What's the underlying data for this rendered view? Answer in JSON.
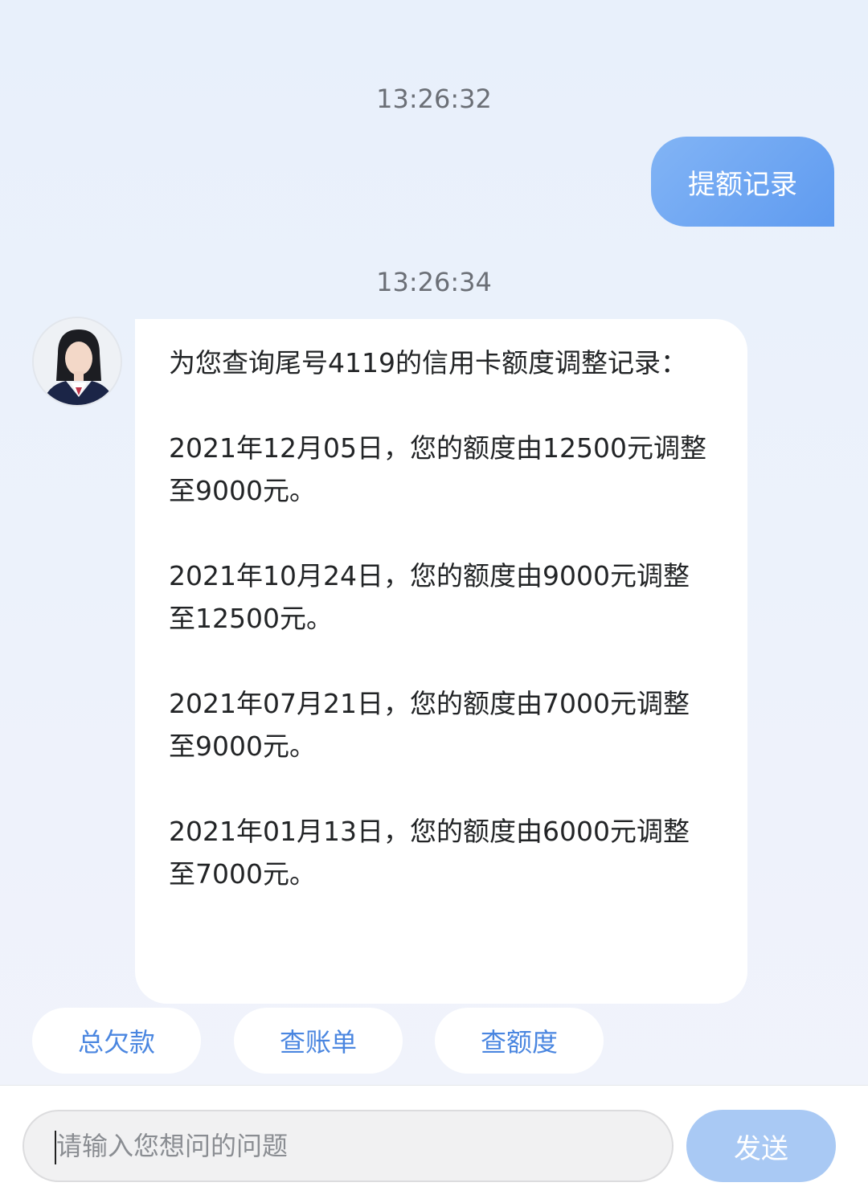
{
  "chat": {
    "timestamp_1": "13:26:32",
    "user_message": "提额记录",
    "timestamp_2": "13:26:34",
    "bot_message": "为您查询尾号4119的信用卡额度调整记录：\n\n2021年12月05日，您的额度由12500元调整至9000元。\n\n2021年10月24日，您的额度由9000元调整至12500元。\n\n2021年07月21日，您的额度由7000元调整至9000元。\n\n2021年01月13日，您的额度由6000元调整至7000元。"
  },
  "quick_replies": [
    {
      "label": "总欠款"
    },
    {
      "label": "查账单"
    },
    {
      "label": "查额度"
    }
  ],
  "input": {
    "placeholder": "请输入您想问的问题",
    "value": ""
  },
  "send_button": {
    "label": "发送"
  },
  "colors": {
    "user_bubble": "#6fa6f2",
    "quick_reply_text": "#4a86e0",
    "send_button_disabled": "#a9c9f4"
  }
}
